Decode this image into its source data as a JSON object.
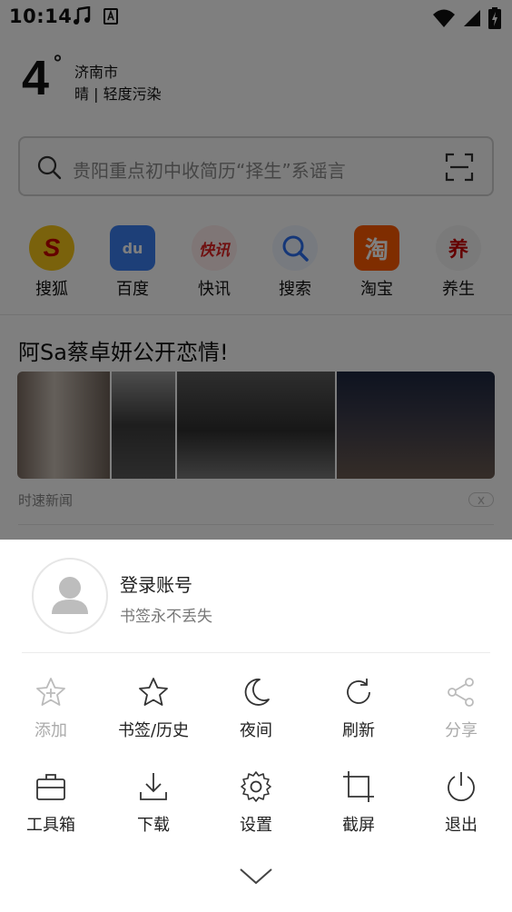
{
  "status_bar": {
    "time": "10:14",
    "icons": [
      "music-note-icon",
      "a-icon",
      "wifi-icon",
      "signal-icon",
      "battery-charging-icon"
    ]
  },
  "weather": {
    "temperature": "4",
    "degree": "°",
    "city": "济南市",
    "condition": "晴 | 轻度污染"
  },
  "search": {
    "placeholder": "贵阳重点初中收简历“择生”系谣言"
  },
  "shortcuts": [
    {
      "label": "搜狐",
      "icon": "sohu-icon",
      "color": "#f5c518"
    },
    {
      "label": "百度",
      "icon": "baidu-icon",
      "color": "#3b7ff1"
    },
    {
      "label": "快讯",
      "icon": "kuaixun-icon",
      "color": "#ffe8e8"
    },
    {
      "label": "搜索",
      "icon": "search-icon",
      "color": "#eaf2ff"
    },
    {
      "label": "淘宝",
      "icon": "taobao-icon",
      "color": "#ff5a00"
    },
    {
      "label": "养生",
      "icon": "yangsheng-icon",
      "color": "#ffffff"
    }
  ],
  "shortcut_glyphs": {
    "sohu": "S",
    "baidu": "du",
    "kuaixun": "快讯",
    "taobao": "淘",
    "yangsheng": "养"
  },
  "news": {
    "title": "阿Sa蔡卓妍公开恋情!",
    "source": "时速新闻"
  },
  "sheet": {
    "login_title": "登录账号",
    "login_subtitle": "书签永不丢失",
    "row1": [
      {
        "label": "添加",
        "icon": "star-plus-icon",
        "enabled": false
      },
      {
        "label": "书签/历史",
        "icon": "star-icon",
        "enabled": true
      },
      {
        "label": "夜间",
        "icon": "moon-icon",
        "enabled": true
      },
      {
        "label": "刷新",
        "icon": "refresh-icon",
        "enabled": true
      },
      {
        "label": "分享",
        "icon": "share-icon",
        "enabled": false
      }
    ],
    "row2": [
      {
        "label": "工具箱",
        "icon": "toolbox-icon",
        "enabled": true
      },
      {
        "label": "下载",
        "icon": "download-icon",
        "enabled": true
      },
      {
        "label": "设置",
        "icon": "gear-icon",
        "enabled": true
      },
      {
        "label": "截屏",
        "icon": "crop-icon",
        "enabled": true
      },
      {
        "label": "退出",
        "icon": "power-icon",
        "enabled": true
      }
    ]
  }
}
